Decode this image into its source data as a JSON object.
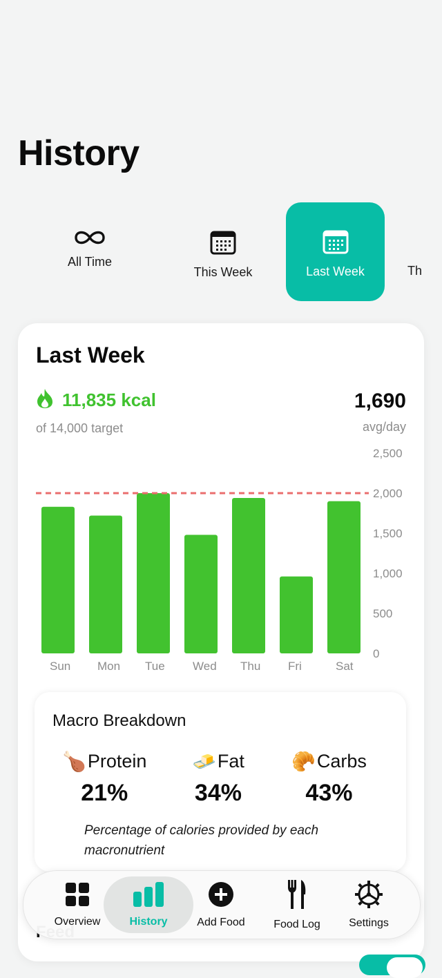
{
  "page": {
    "title": "History"
  },
  "range_tabs": [
    {
      "label": "All Time",
      "icon": "infinity-icon",
      "selected": false
    },
    {
      "label": "This Week",
      "icon": "calendar-icon",
      "selected": false
    },
    {
      "label": "Last Week",
      "icon": "calendar-icon",
      "selected": true
    },
    {
      "label": "Th",
      "icon": "",
      "selected": false
    }
  ],
  "summary": {
    "title": "Last Week",
    "total_kcal": "11,835 kcal",
    "target": "of 14,000 target",
    "avg_value": "1,690",
    "avg_label": "avg/day"
  },
  "chart_data": {
    "type": "bar",
    "title": "",
    "categories": [
      "Sun",
      "Mon",
      "Tue",
      "Wed",
      "Thu",
      "Fri",
      "Sat"
    ],
    "values": [
      1830,
      1720,
      2000,
      1480,
      1940,
      960,
      1900
    ],
    "ylim": [
      0,
      2500
    ],
    "yticks": [
      0,
      500,
      1000,
      1500,
      2000,
      2500
    ],
    "ytick_labels": [
      "0",
      "500",
      "1,000",
      "1,500",
      "2,000",
      "2,500"
    ],
    "target_line": 2000,
    "bar_color": "#42c22f",
    "target_color": "#ea6e6e",
    "y_axis_side": "right",
    "grid": false
  },
  "macros": {
    "title": "Macro Breakdown",
    "items": [
      {
        "emoji": "🍗",
        "name": "Protein",
        "percent": "21%"
      },
      {
        "emoji": "🧈",
        "name": "Fat",
        "percent": "34%"
      },
      {
        "emoji": "🥐",
        "name": "Carbs",
        "percent": "43%"
      }
    ],
    "note": "Percentage of calories provided by each macronutrient"
  },
  "feed": {
    "label": "Feed"
  },
  "nav": [
    {
      "label": "Overview",
      "icon": "grid-icon",
      "active": false
    },
    {
      "label": "History",
      "icon": "bar-chart-icon",
      "active": true
    },
    {
      "label": "Add Food",
      "icon": "plus-circle-icon",
      "active": false
    },
    {
      "label": "Food Log",
      "icon": "fork-knife-icon",
      "active": false
    },
    {
      "label": "Settings",
      "icon": "gear-icon",
      "active": false
    }
  ],
  "colors": {
    "accent": "#08bda6",
    "kcal_green": "#40c22f",
    "bar_green": "#42c22f",
    "target_red": "#ea6e6e"
  }
}
